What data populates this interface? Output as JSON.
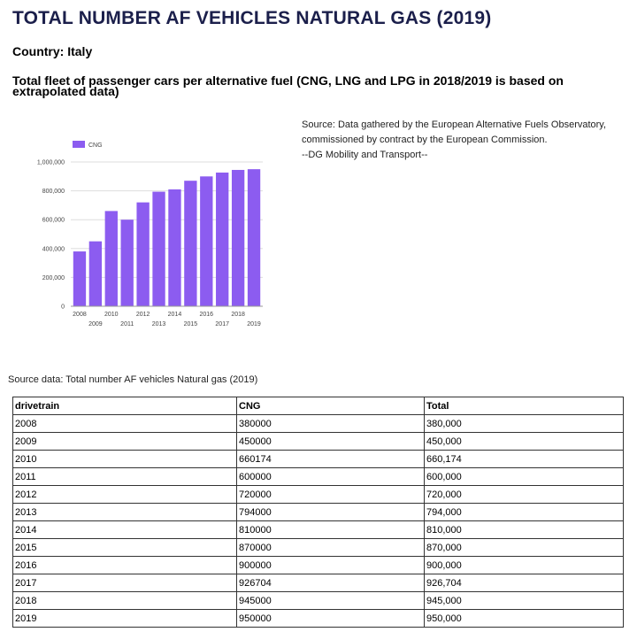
{
  "header": {
    "title": "TOTAL NUMBER AF VEHICLES NATURAL GAS (2019)",
    "country": "Country: Italy",
    "subtitle": "Total fleet of passenger cars per alternative fuel (CNG, LNG and LPG in 2018/2019 is based on extrapolated data)"
  },
  "source_note": [
    "Source: Data gathered by the European Alternative Fuels Observatory,",
    "commissioned by contract by the European Commission.",
    "--DG Mobility and Transport--"
  ],
  "colors": {
    "bar": "#8c5cf0",
    "grid": "#dddddd",
    "axis": "#999999",
    "title": "#1b1f4b"
  },
  "chart_data": {
    "type": "bar",
    "title": "",
    "xlabel": "",
    "ylabel": "",
    "legend": "top-left",
    "grid": true,
    "ylim": [
      0,
      1000000
    ],
    "yticks": [
      "0",
      "200,000",
      "400,000",
      "600,000",
      "800,000",
      "1,000,000"
    ],
    "ytick_values": [
      0,
      200000,
      400000,
      600000,
      800000,
      1000000
    ],
    "categories": [
      "2008",
      "2009",
      "2010",
      "2011",
      "2012",
      "2013",
      "2014",
      "2015",
      "2016",
      "2017",
      "2018",
      "2019"
    ],
    "series": [
      {
        "name": "CNG",
        "values": [
          380000,
          450000,
          660174,
          600000,
          720000,
          794000,
          810000,
          870000,
          900000,
          926704,
          945000,
          950000
        ]
      }
    ]
  },
  "table": {
    "caption": "Source data: Total number AF vehicles Natural gas (2019)",
    "headers": [
      "drivetrain",
      "CNG",
      "Total"
    ],
    "rows": [
      [
        "2008",
        "380000",
        "380,000"
      ],
      [
        "2009",
        "450000",
        "450,000"
      ],
      [
        "2010",
        "660174",
        "660,174"
      ],
      [
        "2011",
        "600000",
        "600,000"
      ],
      [
        "2012",
        "720000",
        "720,000"
      ],
      [
        "2013",
        "794000",
        "794,000"
      ],
      [
        "2014",
        "810000",
        "810,000"
      ],
      [
        "2015",
        "870000",
        "870,000"
      ],
      [
        "2016",
        "900000",
        "900,000"
      ],
      [
        "2017",
        "926704",
        "926,704"
      ],
      [
        "2018",
        "945000",
        "945,000"
      ],
      [
        "2019",
        "950000",
        "950,000"
      ]
    ]
  }
}
